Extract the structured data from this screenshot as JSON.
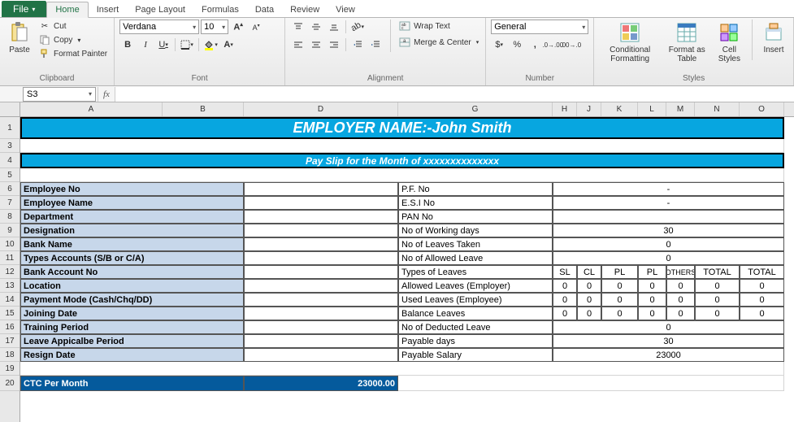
{
  "tabs": {
    "file": "File",
    "home": "Home",
    "insert": "Insert",
    "pagelayout": "Page Layout",
    "formulas": "Formulas",
    "data": "Data",
    "review": "Review",
    "view": "View"
  },
  "clipboard": {
    "paste": "Paste",
    "cut": "Cut",
    "copy": "Copy",
    "fp": "Format Painter",
    "group": "Clipboard"
  },
  "font": {
    "family": "Verdana",
    "size": "10",
    "group": "Font"
  },
  "align": {
    "wrap": "Wrap Text",
    "merge": "Merge & Center",
    "group": "Alignment"
  },
  "number": {
    "format": "General",
    "group": "Number"
  },
  "styles": {
    "cf": "Conditional Formatting",
    "fat": "Format as Table",
    "cs": "Cell Styles",
    "ins": "Insert",
    "group": "Styles"
  },
  "namebox": "S3",
  "fx": "fx",
  "cols": {
    "A": "A",
    "B": "B",
    "D": "D",
    "G": "G",
    "H": "H",
    "J": "J",
    "K": "K",
    "L": "L",
    "M": "M",
    "N": "N",
    "O": "O"
  },
  "rows": [
    "1",
    "3",
    "4",
    "5",
    "6",
    "7",
    "8",
    "9",
    "10",
    "11",
    "12",
    "13",
    "14",
    "15",
    "16",
    "17",
    "18",
    "19",
    "20"
  ],
  "sheet": {
    "title": "EMPLOYER NAME:-John Smith",
    "subtitle": "Pay Slip for the Month of xxxxxxxxxxxxxx",
    "left": {
      "empno": "Employee No",
      "empname": "Employee Name",
      "dept": "Department",
      "desig": "Designation",
      "bank": "Bank Name",
      "acct": "Types Accounts (S/B or C/A)",
      "bano": "Bank Account No",
      "loc": "Location",
      "pm": "Payment Mode (Cash/Chq/DD)",
      "jd": "Joining Date",
      "tp": "Training Period",
      "lap": "Leave Appicalbe Period",
      "rd": "Resign Date",
      "ctc": "CTC Per Month",
      "ctcval": "23000.00"
    },
    "right": {
      "pf": "P.F. No",
      "esi": "E.S.I No",
      "pan": "PAN No",
      "wd": "No of Working days",
      "lt": "No of Leaves Taken",
      "al": "No of Allowed Leave",
      "tl": "Types of Leaves",
      "ale": "Allowed Leaves (Employer)",
      "ule": "Used Leaves (Employee)",
      "bl": "Balance Leaves",
      "dl": "No of Deducted Leave",
      "pd": "Payable days",
      "ps": "Payable Salary",
      "dash": "-",
      "v30": "30",
      "v0": "0",
      "v23000": "23000",
      "hdr": {
        "sl": "SL",
        "cl": "CL",
        "pl1": "PL",
        "pl2": "PL",
        "oth": "OTHERS",
        "tot": "TOTAL"
      }
    }
  },
  "chart_data": {
    "type": "table",
    "title": "Pay Slip for the Month of xxxxxxxxxxxxxx",
    "employer": "John Smith",
    "employee_fields": [
      {
        "label": "Employee No",
        "value": ""
      },
      {
        "label": "Employee Name",
        "value": ""
      },
      {
        "label": "Department",
        "value": ""
      },
      {
        "label": "Designation",
        "value": ""
      },
      {
        "label": "Bank Name",
        "value": ""
      },
      {
        "label": "Types Accounts (S/B or C/A)",
        "value": ""
      },
      {
        "label": "Bank Account No",
        "value": ""
      },
      {
        "label": "Location",
        "value": ""
      },
      {
        "label": "Payment Mode (Cash/Chq/DD)",
        "value": ""
      },
      {
        "label": "Joining Date",
        "value": ""
      },
      {
        "label": "Training Period",
        "value": ""
      },
      {
        "label": "Leave Appicalbe Period",
        "value": ""
      },
      {
        "label": "Resign Date",
        "value": ""
      }
    ],
    "stat_fields": [
      {
        "label": "P.F. No",
        "value": "-"
      },
      {
        "label": "E.S.I No",
        "value": "-"
      },
      {
        "label": "PAN No",
        "value": ""
      },
      {
        "label": "No of Working days",
        "value": 30
      },
      {
        "label": "No of Leaves Taken",
        "value": 0
      },
      {
        "label": "No of Allowed Leave",
        "value": 0
      },
      {
        "label": "No of Deducted Leave",
        "value": 0
      },
      {
        "label": "Payable days",
        "value": 30
      },
      {
        "label": "Payable Salary",
        "value": 23000
      }
    ],
    "leaves_table": {
      "columns": [
        "SL",
        "CL",
        "PL",
        "PL",
        "OTHERS",
        "TOTAL"
      ],
      "rows": [
        {
          "label": "Allowed Leaves (Employer)",
          "values": [
            0,
            0,
            0,
            0,
            0,
            0
          ]
        },
        {
          "label": "Used Leaves (Employee)",
          "values": [
            0,
            0,
            0,
            0,
            0,
            0
          ]
        },
        {
          "label": "Balance Leaves",
          "values": [
            0,
            0,
            0,
            0,
            0,
            0
          ]
        }
      ]
    },
    "ctc_per_month": 23000.0
  }
}
